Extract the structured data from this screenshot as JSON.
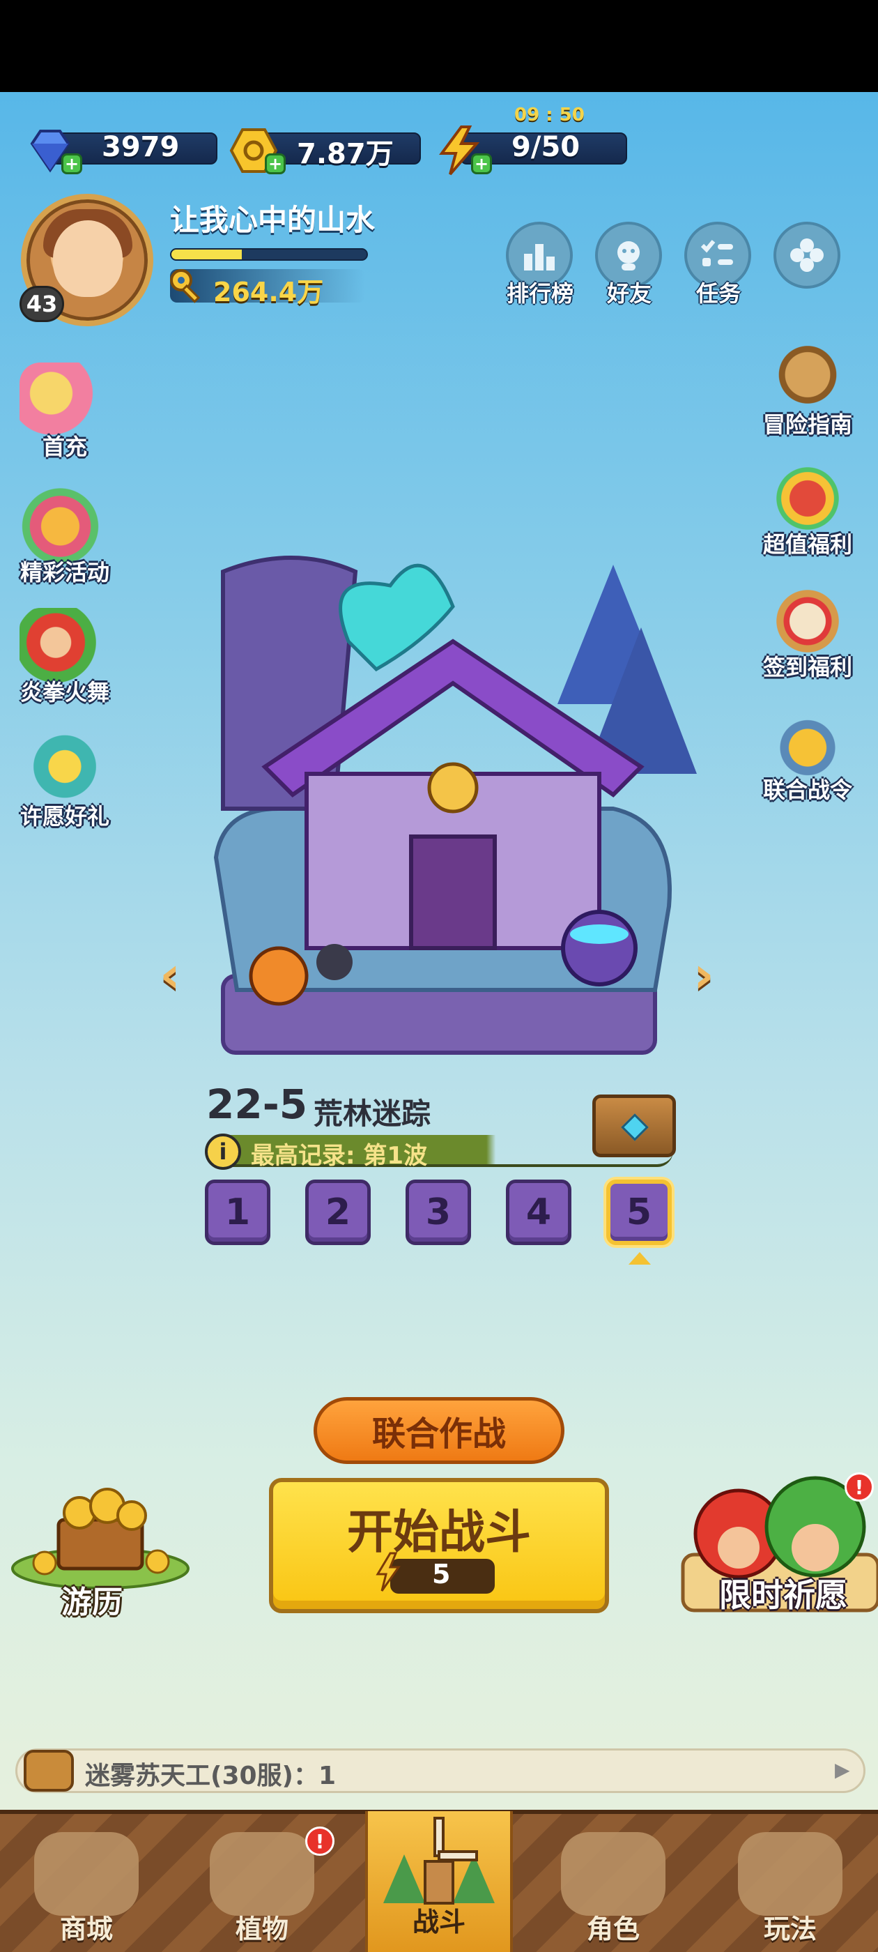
{
  "currencies": {
    "gems": "3979",
    "coins": "7.87万",
    "energy": "9/50",
    "energy_timer": "09 : 50"
  },
  "profile": {
    "name": "让我心中的山水",
    "level": "43",
    "power": "264.4万",
    "xp_fraction": 0.36
  },
  "top_menu": {
    "ranking": "排行榜",
    "friends": "好友",
    "tasks": "任务"
  },
  "left_side": {
    "first_charge": "首充",
    "events": "精彩活动",
    "fire_fist": "炎拳火舞",
    "wish_gift": "许愿好礼"
  },
  "right_side": {
    "guide": "冒险指南",
    "value_welfare": "超值福利",
    "signin_welfare": "签到福利",
    "battle_pass": "联合战令"
  },
  "stage": {
    "code": "22-5",
    "name": "荒林迷踪",
    "record": "最高记录: 第1波",
    "waves": [
      "1",
      "2",
      "3",
      "4",
      "5"
    ],
    "selected_wave": "5"
  },
  "actions": {
    "coop": "联合作战",
    "start": "开始战斗",
    "cost": "5",
    "travel": "游历",
    "limited_wish": "限时祈愿"
  },
  "chat": {
    "message": "迷雾苏天工(30服)：1"
  },
  "nav": {
    "shop": "商城",
    "plants": "植物",
    "battle": "战斗",
    "character": "角色",
    "gameplay": "玩法"
  },
  "colors": {
    "accent_yellow": "#f9c512",
    "coop_orange": "#ef7a14",
    "wave_purple": "#7e5bb6"
  }
}
